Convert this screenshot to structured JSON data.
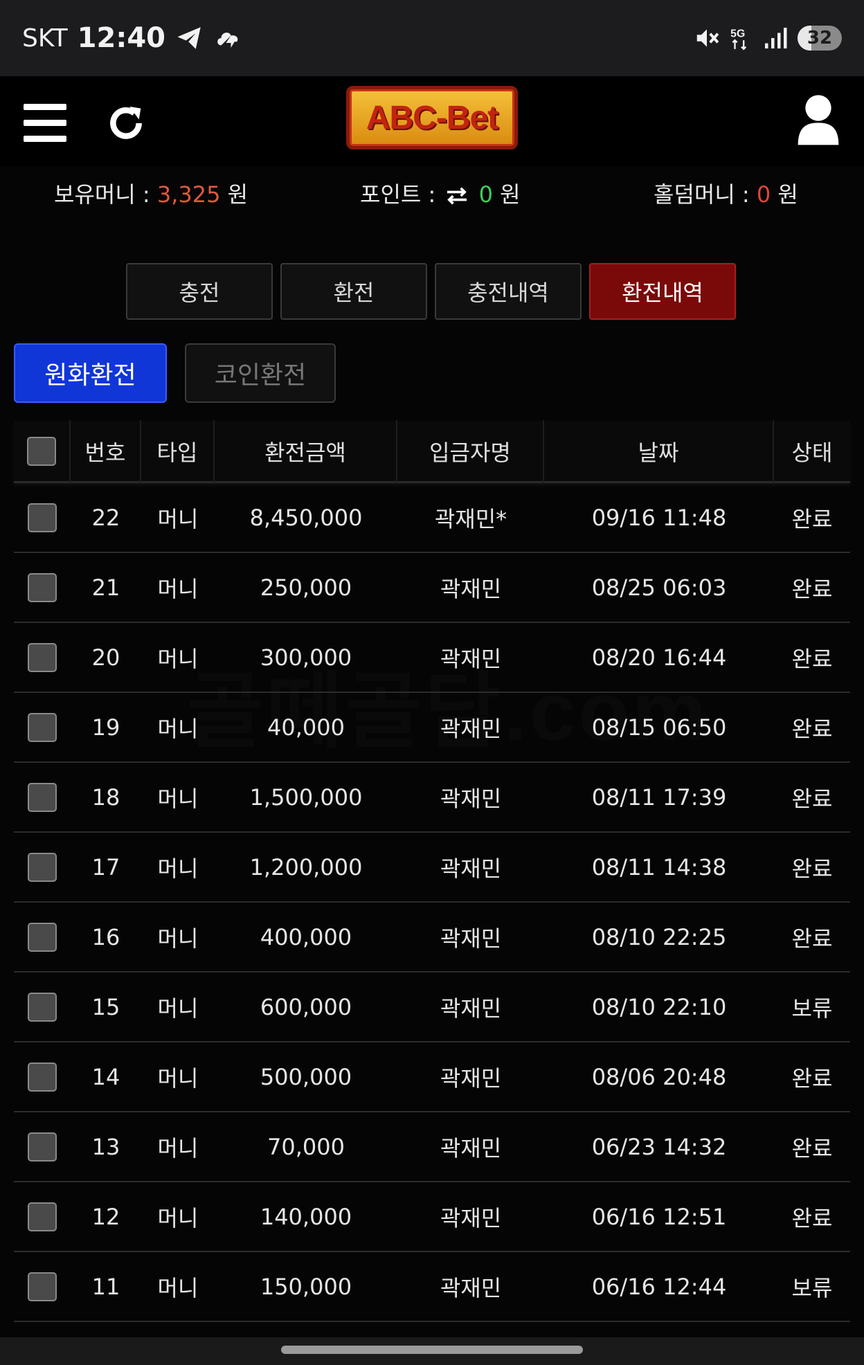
{
  "status_bar": {
    "carrier": "SKT",
    "time": "12:40",
    "network": "5G",
    "battery": "32"
  },
  "header": {
    "logo_text": "ABC-Bet"
  },
  "balances": {
    "money_label": "보유머니 :",
    "money_value": "3,325",
    "point_label": "포인트 :",
    "point_value": "0",
    "holdem_label": "홀덤머니 :",
    "holdem_value": "0",
    "unit": "원"
  },
  "tabs": [
    {
      "label": "충전"
    },
    {
      "label": "환전"
    },
    {
      "label": "충전내역"
    },
    {
      "label": "환전내역"
    }
  ],
  "active_tab": "환전내역",
  "subtabs": {
    "krw_label": "원화환전",
    "coin_label": "코인환전"
  },
  "table": {
    "headers": [
      "번호",
      "타입",
      "환전금액",
      "입금자명",
      "날짜",
      "상태"
    ],
    "rows": [
      {
        "no": "22",
        "type": "머니",
        "amount": "8,450,000",
        "name": "곽재민*",
        "date": "09/16 11:48",
        "status": "완료"
      },
      {
        "no": "21",
        "type": "머니",
        "amount": "250,000",
        "name": "곽재민",
        "date": "08/25 06:03",
        "status": "완료"
      },
      {
        "no": "20",
        "type": "머니",
        "amount": "300,000",
        "name": "곽재민",
        "date": "08/20 16:44",
        "status": "완료"
      },
      {
        "no": "19",
        "type": "머니",
        "amount": "40,000",
        "name": "곽재민",
        "date": "08/15 06:50",
        "status": "완료"
      },
      {
        "no": "18",
        "type": "머니",
        "amount": "1,500,000",
        "name": "곽재민",
        "date": "08/11 17:39",
        "status": "완료"
      },
      {
        "no": "17",
        "type": "머니",
        "amount": "1,200,000",
        "name": "곽재민",
        "date": "08/11 14:38",
        "status": "완료"
      },
      {
        "no": "16",
        "type": "머니",
        "amount": "400,000",
        "name": "곽재민",
        "date": "08/10 22:25",
        "status": "완료"
      },
      {
        "no": "15",
        "type": "머니",
        "amount": "600,000",
        "name": "곽재민",
        "date": "08/10 22:10",
        "status": "보류"
      },
      {
        "no": "14",
        "type": "머니",
        "amount": "500,000",
        "name": "곽재민",
        "date": "08/06 20:48",
        "status": "완료"
      },
      {
        "no": "13",
        "type": "머니",
        "amount": "70,000",
        "name": "곽재민",
        "date": "06/23 14:32",
        "status": "완료"
      },
      {
        "no": "12",
        "type": "머니",
        "amount": "140,000",
        "name": "곽재민",
        "date": "06/16 12:51",
        "status": "완료"
      },
      {
        "no": "11",
        "type": "머니",
        "amount": "150,000",
        "name": "곽재민",
        "date": "06/16 12:44",
        "status": "보류"
      }
    ]
  },
  "watermark": "골떼골담.com",
  "colors": {
    "money_value": "#e05a3a",
    "point_value": "#3ccf5a",
    "holdem_value": "#e0443a",
    "active_tab": "#7a0a0a",
    "active_subtab": "#1036d8"
  },
  "icons": [
    "menu-icon",
    "refresh-icon",
    "user-icon",
    "telegram-icon",
    "cloud-icon",
    "mute-icon",
    "signal-icon",
    "swap-icon"
  ]
}
